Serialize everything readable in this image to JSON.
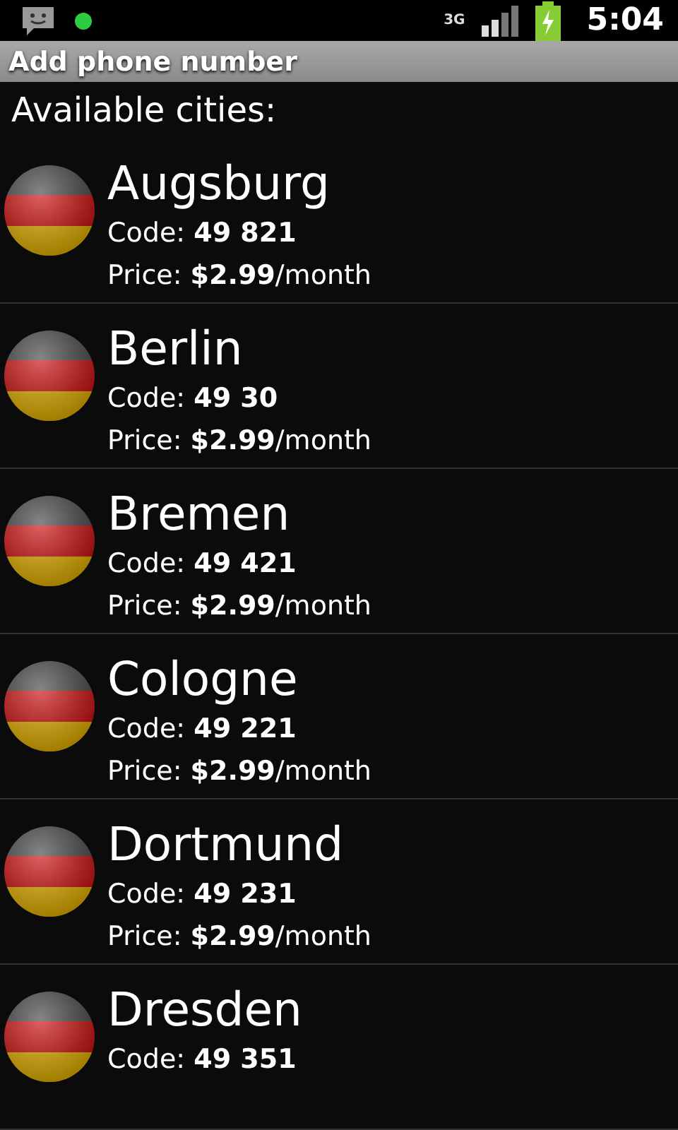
{
  "status_bar": {
    "time": "5:04",
    "network": "3G"
  },
  "title_bar": {
    "title": "Add phone number"
  },
  "heading": "Available cities:",
  "cities": [
    {
      "name": "Augsburg",
      "code": "Code: **49 821**",
      "price": "Price: **$2.99**/month"
    },
    {
      "name": "Berlin",
      "code": "Code: **49 30**",
      "price": "Price: **$2.99**/month"
    },
    {
      "name": "Bremen",
      "code": "Code: **49 421**",
      "price": "Price: **$2.99**/month"
    },
    {
      "name": "Cologne",
      "code": "Code: **49 221**",
      "price": "Price: **$2.99**/month"
    },
    {
      "name": "Dortmund",
      "code": "Code: **49 231**",
      "price": "Price: **$2.99**/month"
    },
    {
      "name": "Dresden",
      "code": "Code: **49 351**"
    }
  ]
}
